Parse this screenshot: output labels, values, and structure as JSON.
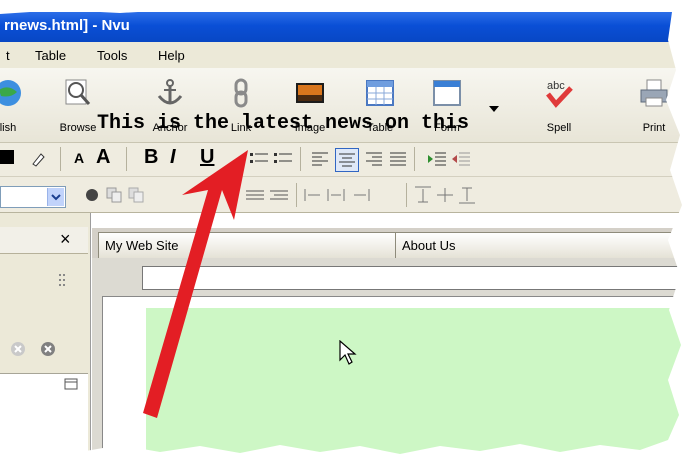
{
  "window": {
    "title": "rnews.html] - Nvu"
  },
  "menu": {
    "fragment": "t",
    "items": [
      "Table",
      "Tools",
      "Help"
    ]
  },
  "toolbar": {
    "buttons": [
      {
        "label": "lish",
        "icon": "globe-publish-icon"
      },
      {
        "label": "Browse",
        "icon": "magnifier-icon"
      },
      {
        "label": "Anchor",
        "icon": "anchor-icon"
      },
      {
        "label": "Link",
        "icon": "chain-link-icon"
      },
      {
        "label": "Image",
        "icon": "picture-icon"
      },
      {
        "label": "Table",
        "icon": "table-icon"
      },
      {
        "label": "Form",
        "icon": "form-icon"
      },
      {
        "label": "Spell",
        "icon": "spellcheck-icon"
      },
      {
        "label": "Print",
        "icon": "printer-icon"
      }
    ],
    "spell_badge": "abc"
  },
  "format": {
    "bold": "B",
    "italic": "I",
    "underline": "U",
    "font_smaller": "A",
    "font_larger": "A"
  },
  "tabs": [
    {
      "label": "My Web Site"
    },
    {
      "label": "About Us"
    }
  ],
  "document": {
    "text": "This is the latest news on this"
  },
  "panel": {
    "close": "×"
  },
  "colors": {
    "titlebar": "#0a4fd6",
    "page_background": "#cdf7c5",
    "arrow": "#e31e24"
  }
}
